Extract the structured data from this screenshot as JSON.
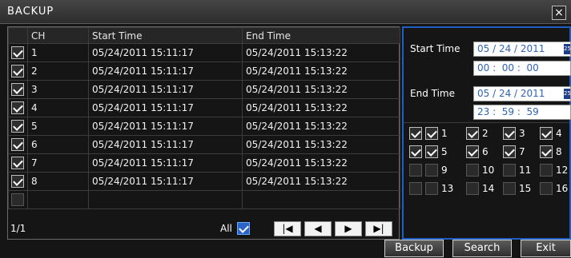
{
  "window": {
    "title": "BACKUP",
    "close_glyph": "×"
  },
  "table": {
    "headers": [
      "CH",
      "Start Time",
      "End Time"
    ],
    "rows": [
      {
        "checked": true,
        "ch": "1",
        "start": "05/24/2011 15:11:17",
        "end": "05/24/2011 15:13:22"
      },
      {
        "checked": true,
        "ch": "2",
        "start": "05/24/2011 15:11:17",
        "end": "05/24/2011 15:13:22"
      },
      {
        "checked": true,
        "ch": "3",
        "start": "05/24/2011 15:11:17",
        "end": "05/24/2011 15:13:22"
      },
      {
        "checked": true,
        "ch": "4",
        "start": "05/24/2011 15:11:17",
        "end": "05/24/2011 15:13:22"
      },
      {
        "checked": true,
        "ch": "5",
        "start": "05/24/2011 15:11:17",
        "end": "05/24/2011 15:13:22"
      },
      {
        "checked": true,
        "ch": "6",
        "start": "05/24/2011 15:11:17",
        "end": "05/24/2011 15:13:22"
      },
      {
        "checked": true,
        "ch": "7",
        "start": "05/24/2011 15:11:17",
        "end": "05/24/2011 15:13:22"
      },
      {
        "checked": true,
        "ch": "8",
        "start": "05/24/2011 15:11:17",
        "end": "05/24/2011 15:13:22"
      },
      {
        "checked": false,
        "ch": "",
        "start": "",
        "end": ""
      }
    ],
    "page": "1/1",
    "all_label": "All",
    "all_checked": true,
    "nav": {
      "first": "|◀",
      "prev": "◀",
      "next": "▶",
      "last": "▶|"
    }
  },
  "search": {
    "start_label": "Start Time",
    "start_date": "05 / 24 / 2011",
    "start_time": "00 :  00 :  00",
    "end_label": "End Time",
    "end_date": "05 / 24 / 2011",
    "end_time": "23 :  59 :  59",
    "calendar_glyph": "25"
  },
  "channels": {
    "rows": [
      {
        "row_checked": true,
        "items": [
          {
            "label": "1",
            "checked": true
          },
          {
            "label": "2",
            "checked": true
          },
          {
            "label": "3",
            "checked": true
          },
          {
            "label": "4",
            "checked": true
          }
        ]
      },
      {
        "row_checked": true,
        "items": [
          {
            "label": "5",
            "checked": true
          },
          {
            "label": "6",
            "checked": true
          },
          {
            "label": "7",
            "checked": true
          },
          {
            "label": "8",
            "checked": true
          }
        ]
      },
      {
        "row_checked": false,
        "items": [
          {
            "label": "9",
            "checked": false
          },
          {
            "label": "10",
            "checked": false
          },
          {
            "label": "11",
            "checked": false
          },
          {
            "label": "12",
            "checked": false
          }
        ]
      },
      {
        "row_checked": false,
        "items": [
          {
            "label": "13",
            "checked": false
          },
          {
            "label": "14",
            "checked": false
          },
          {
            "label": "15",
            "checked": false
          },
          {
            "label": "16",
            "checked": false
          }
        ]
      }
    ]
  },
  "buttons": {
    "backup": "Backup",
    "search": "Search",
    "exit": "Exit"
  },
  "colors": {
    "accent": "#1f5fc2",
    "time_text": "#2f63b8",
    "background": "#151515"
  }
}
